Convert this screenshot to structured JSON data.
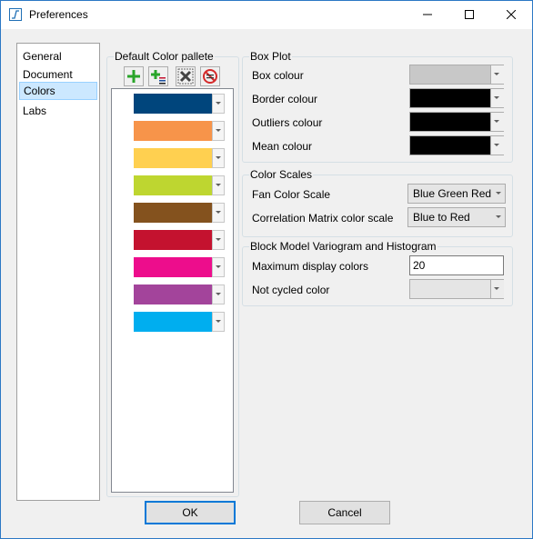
{
  "window": {
    "title": "Preferences"
  },
  "nav": {
    "items": [
      {
        "label": "General"
      },
      {
        "label": "Document"
      },
      {
        "label": "Colors"
      },
      {
        "label": "Labs"
      }
    ],
    "selected": "Colors"
  },
  "palette": {
    "label": "Default Color pallete",
    "toolbar": [
      {
        "icon": "add-icon"
      },
      {
        "icon": "add-list-icon"
      },
      {
        "icon": "delete-icon"
      },
      {
        "icon": "clear-icon"
      }
    ],
    "colors": [
      "#00457c",
      "#f7944a",
      "#ffd050",
      "#bed630",
      "#84521e",
      "#c4122f",
      "#ed0d8c",
      "#a3449b",
      "#00aeef"
    ]
  },
  "box_plot": {
    "label": "Box Plot",
    "rows": [
      {
        "label": "Box colour",
        "color": "#c8c8c8"
      },
      {
        "label": "Border colour",
        "color": "#000000"
      },
      {
        "label": "Outliers colour",
        "color": "#000000"
      },
      {
        "label": "Mean colour",
        "color": "#000000"
      }
    ]
  },
  "color_scales": {
    "label": "Color Scales",
    "fan_label": "Fan Color Scale",
    "fan_value": "Blue Green Red",
    "corr_label": "Correlation Matrix color scale",
    "corr_value": "Blue to Red"
  },
  "block_model": {
    "label": "Block Model Variogram and Histogram",
    "max_label": "Maximum display colors",
    "max_value": "20",
    "not_cycled_label": "Not cycled color"
  },
  "buttons": {
    "ok": "OK",
    "cancel": "Cancel"
  }
}
